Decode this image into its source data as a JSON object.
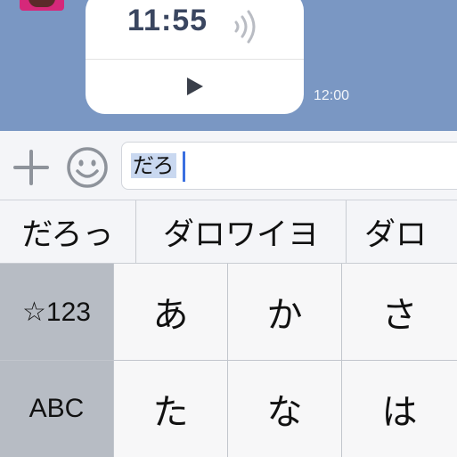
{
  "chat": {
    "voice_message": {
      "duration": "11:55",
      "sound_icon": "sound-waves-icon",
      "play_icon": "play-icon"
    },
    "sent_time": "12:00"
  },
  "input_bar": {
    "plus_icon": "plus-icon",
    "emoji_icon": "smiley-icon",
    "text_value": "だろ"
  },
  "candidates": [
    "だろっ",
    "ダロワイヨ",
    "ダロ"
  ],
  "keyboard": {
    "symbols_key": "☆123",
    "abc_key": "ABC",
    "kana_keys": [
      "あ",
      "か",
      "さ",
      "た",
      "な",
      "は"
    ]
  },
  "colors": {
    "chat_background": "#7a97c3",
    "caret": "#3a6fe0",
    "selection": "#c9d8f0"
  }
}
